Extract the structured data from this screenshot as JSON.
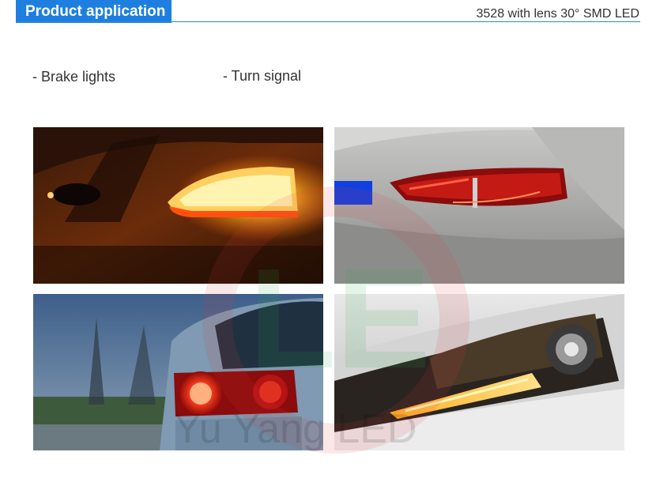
{
  "header": {
    "title": "Product application",
    "spec": "3528 with lens 30° SMD LED"
  },
  "applications": [
    {
      "label": "- Brake lights"
    },
    {
      "label": "- Turn signal"
    }
  ],
  "watermark": {
    "text": "Yu Yang LED"
  },
  "colors": {
    "accent": "#1e7fe0",
    "amber": "#ffb020",
    "red": "#d01818"
  }
}
